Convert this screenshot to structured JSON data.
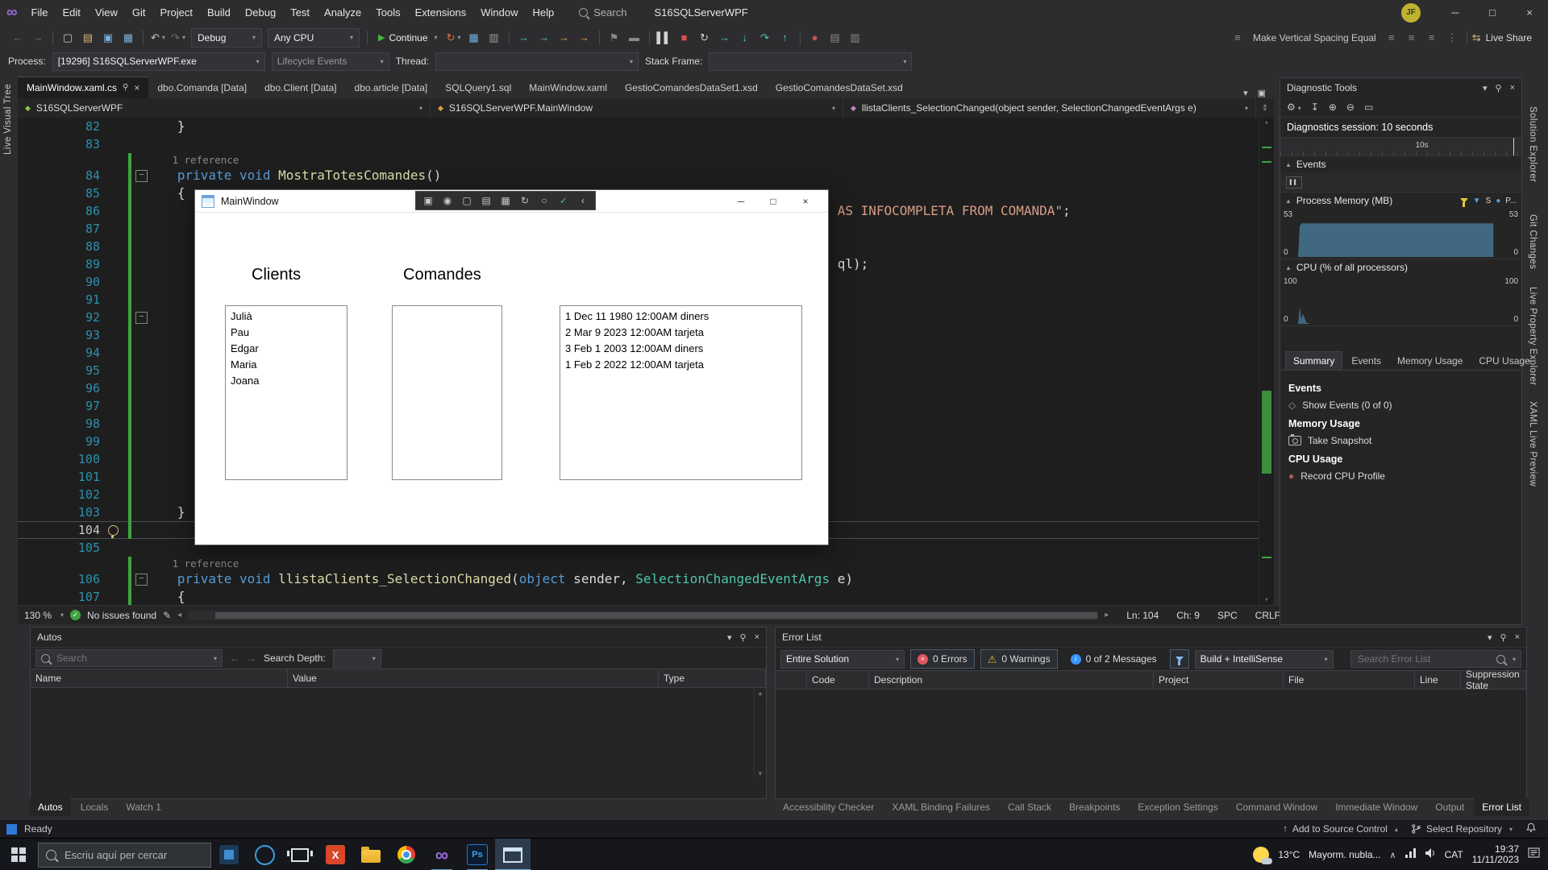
{
  "theme": {
    "accent": "#007acc",
    "editor_bg": "#1e1e1e",
    "shell_bg": "#2d2d30",
    "change_green": "#3fa33f",
    "stop_red": "#d85050"
  },
  "titlebar": {
    "menu": [
      "File",
      "Edit",
      "View",
      "Git",
      "Project",
      "Build",
      "Debug",
      "Test",
      "Analyze",
      "Tools",
      "Extensions",
      "Window",
      "Help"
    ],
    "search_label": "Search",
    "solution_title": "S16SQLServerWPF",
    "avatar_initials": "JF"
  },
  "toolbar": {
    "items": [
      {
        "k": "i",
        "n": "nav-back-icon",
        "g": "←",
        "c": "#6e6e6e"
      },
      {
        "k": "i",
        "n": "nav-forward-icon",
        "g": "→",
        "c": "#6e6e6e"
      },
      {
        "k": "s"
      },
      {
        "k": "i",
        "n": "new-file-icon",
        "g": "▢",
        "c": "#c8c8c8"
      },
      {
        "k": "i",
        "n": "open-file-icon",
        "g": "▤",
        "c": "#d8b26e"
      },
      {
        "k": "i",
        "n": "save-icon",
        "g": "▣",
        "c": "#7ab0dc"
      },
      {
        "k": "i",
        "n": "save-all-icon",
        "g": "▦",
        "c": "#7ab0dc"
      },
      {
        "k": "s"
      },
      {
        "k": "i",
        "n": "undo-icon",
        "g": "↶",
        "c": "#c8c8c8",
        "caret": 1
      },
      {
        "k": "i",
        "n": "redo-icon",
        "g": "↷",
        "c": "#6e6e6e",
        "caret": 1
      },
      {
        "k": "sel",
        "n": "debug-config-select",
        "label": "Debug",
        "w": 72
      },
      {
        "k": "sel",
        "n": "platform-select",
        "label": "Any CPU",
        "w": 98
      },
      {
        "k": "s"
      },
      {
        "k": "btn",
        "n": "continue-button",
        "label": "Continue"
      },
      {
        "k": "i",
        "n": "hot-reload-icon",
        "g": "↻",
        "c": "#e0703c",
        "caret": 1
      },
      {
        "k": "i",
        "n": "performance-profiler-icon",
        "g": "▦",
        "c": "#7ab0dc"
      },
      {
        "k": "i",
        "n": "diagnostics-icon",
        "g": "▥",
        "c": "#9a9a9a"
      },
      {
        "k": "s"
      },
      {
        "k": "i",
        "n": "navigate-backward-code-icon",
        "g": "→",
        "c": "#4ec9b0"
      },
      {
        "k": "i",
        "n": "navigate-forward-code-icon",
        "g": "→",
        "c": "#4ec9b0"
      },
      {
        "k": "i",
        "n": "goto-definition-icon",
        "g": "→",
        "c": "#e8a33a"
      },
      {
        "k": "i",
        "n": "goto-implementation-icon",
        "g": "→",
        "c": "#e8a33a"
      },
      {
        "k": "s"
      },
      {
        "k": "i",
        "n": "bookmark-icon",
        "g": "⚑",
        "c": "#8a8a8a"
      },
      {
        "k": "i",
        "n": "comment-icon",
        "g": "▬",
        "c": "#8a8a8a"
      },
      {
        "k": "s"
      },
      {
        "k": "i",
        "n": "pause-icon",
        "g": "▌▌",
        "c": "#d0d0d0"
      },
      {
        "k": "i",
        "n": "stop-icon",
        "g": "■",
        "c": "#d85050"
      },
      {
        "k": "i",
        "n": "restart-icon",
        "g": "↻",
        "c": "#d0d0d0"
      },
      {
        "k": "i",
        "n": "show-next-statement-icon",
        "g": "→",
        "c": "#4ec9b0"
      },
      {
        "k": "i",
        "n": "step-into-icon",
        "g": "↓",
        "c": "#4ec9b0"
      },
      {
        "k": "i",
        "n": "step-over-icon",
        "g": "↷",
        "c": "#4ec9b0"
      },
      {
        "k": "i",
        "n": "step-out-icon",
        "g": "↑",
        "c": "#4ec9b0"
      },
      {
        "k": "s"
      },
      {
        "k": "i",
        "n": "breakpoints-window-icon",
        "g": "●",
        "c": "#c75050"
      },
      {
        "k": "i",
        "n": "output-window-icon",
        "g": "▤",
        "c": "#8a8a8a"
      },
      {
        "k": "i",
        "n": "find-icon",
        "g": "▥",
        "c": "#8a8a8a"
      },
      {
        "k": "flex"
      },
      {
        "k": "i",
        "n": "align-tops-icon",
        "g": "≡",
        "c": "#8a8a8a"
      },
      {
        "k": "label",
        "n": "make-vertical-spacing-equal-label",
        "label": "Make Vertical Spacing Equal"
      },
      {
        "k": "i",
        "n": "align-lefts-icon",
        "g": "≡",
        "c": "#8a8a8a"
      },
      {
        "k": "i",
        "n": "align-centers-icon",
        "g": "≡",
        "c": "#8a8a8a"
      },
      {
        "k": "i",
        "n": "align-rights-icon",
        "g": "≡",
        "c": "#8a8a8a"
      },
      {
        "k": "i",
        "n": "make-horizontal-spacing-icon",
        "g": "⋮",
        "c": "#8a8a8a"
      },
      {
        "k": "s"
      },
      {
        "k": "live",
        "n": "live-share-button",
        "g": "⇆",
        "label": "Live Share"
      }
    ]
  },
  "process_bar": {
    "process_label": "Process:",
    "process_value": "[19296] S16SQLServerWPF.exe",
    "lifecycle_label": "Lifecycle Events",
    "thread_label": "Thread:",
    "stack_label": "Stack Frame:"
  },
  "doc_tabs": {
    "tabs": [
      {
        "label": "MainWindow.xaml.cs",
        "active": true
      },
      {
        "label": "dbo.Comanda [Data]"
      },
      {
        "label": "dbo.Client [Data]"
      },
      {
        "label": "dbo.article [Data]"
      },
      {
        "label": "SQLQuery1.sql"
      },
      {
        "label": "MainWindow.xaml"
      },
      {
        "label": "GestioComandesDataSet1.xsd"
      },
      {
        "label": "GestioComandesDataSet.xsd"
      }
    ]
  },
  "breadcrumb": {
    "items": [
      {
        "label": "S16SQLServerWPF"
      },
      {
        "label": "S16SQLServerWPF.MainWindow"
      },
      {
        "label": "llistaClients_SelectionChanged(object sender, SelectionChangedEventArgs e)"
      }
    ]
  },
  "editor": {
    "lines": [
      {
        "n": "82",
        "t": [
          [
            "p",
            "   }"
          ]
        ]
      },
      {
        "n": "83",
        "t": []
      },
      {
        "lens": "1 reference",
        "chg": true
      },
      {
        "n": "84",
        "chg": true,
        "fold": true,
        "t": [
          [
            "k",
            "   private void "
          ],
          [
            "m",
            "MostraTotesComandes"
          ],
          [
            "p",
            "()"
          ]
        ]
      },
      {
        "n": "85",
        "chg": true,
        "t": [
          [
            "p",
            "   {"
          ]
        ]
      },
      {
        "n": "86",
        "chg": true,
        "t": [
          [
            "s",
            "AS INFOCOMPLETA FROM COMANDA\"",
            88
          ],
          [
            "p",
            ";"
          ]
        ]
      },
      {
        "n": "87",
        "chg": true,
        "t": []
      },
      {
        "n": "88",
        "chg": true,
        "t": []
      },
      {
        "n": "89",
        "chg": true,
        "t": [
          [
            "p",
            "ql);",
            88
          ]
        ]
      },
      {
        "n": "90",
        "chg": true,
        "t": []
      },
      {
        "n": "91",
        "chg": true,
        "t": []
      },
      {
        "n": "92",
        "chg": true,
        "fold": true,
        "t": []
      },
      {
        "n": "93",
        "chg": true,
        "t": []
      },
      {
        "n": "94",
        "chg": true,
        "t": []
      },
      {
        "n": "95",
        "chg": true,
        "t": []
      },
      {
        "n": "96",
        "chg": true,
        "t": []
      },
      {
        "n": "97",
        "chg": true,
        "t": []
      },
      {
        "n": "98",
        "chg": true,
        "t": []
      },
      {
        "n": "99",
        "chg": true,
        "t": []
      },
      {
        "n": "100",
        "chg": true,
        "t": []
      },
      {
        "n": "101",
        "chg": true,
        "t": []
      },
      {
        "n": "102",
        "chg": true,
        "t": []
      },
      {
        "n": "103",
        "chg": true,
        "t": [
          [
            "p",
            "   }"
          ]
        ]
      },
      {
        "n": "104",
        "chg": true,
        "cur": true,
        "t": []
      },
      {
        "n": "105",
        "t": []
      },
      {
        "lens": "1 reference",
        "chg": true
      },
      {
        "n": "106",
        "chg": true,
        "fold": true,
        "t": [
          [
            "k",
            "   private void "
          ],
          [
            "m",
            "llistaClients_SelectionChanged"
          ],
          [
            "p",
            "("
          ],
          [
            "k",
            "object"
          ],
          [
            "p",
            " sender, "
          ],
          [
            "y",
            "SelectionChangedEventArgs"
          ],
          [
            "p",
            " e)"
          ]
        ]
      },
      {
        "n": "107",
        "chg": true,
        "t": [
          [
            "p",
            "   {"
          ]
        ]
      }
    ],
    "status": {
      "zoom": "130 %",
      "health": "No issues found",
      "ln": "Ln: 104",
      "ch": "Ch: 9",
      "spc": "SPC",
      "eol": "CRLF"
    }
  },
  "wpf_window": {
    "title": "MainWindow",
    "clients_heading": "Clients",
    "comandes_heading": "Comandes",
    "clients": [
      "Julià",
      "Pau",
      "Edgar",
      "Maria",
      "Joana"
    ],
    "comandes": [
      "1 Dec 11 1980 12:00AM diners",
      "2 Mar 9 2023 12:00AM tarjeta",
      "3 Feb 1 2003 12:00AM diners",
      "1 Feb 2 2022 12:00AM tarjeta"
    ],
    "overlay_icons": [
      {
        "n": "select-element-icon",
        "g": "▣"
      },
      {
        "n": "screenshot-icon",
        "g": "◉"
      },
      {
        "n": "inspect-element-icon",
        "g": "▢"
      },
      {
        "n": "show-adorners-icon",
        "g": "▤"
      },
      {
        "n": "show-layout-grid-icon",
        "g": "▦"
      },
      {
        "n": "hot-reload-icon",
        "g": "↻"
      },
      {
        "n": "accessibility-checker-icon",
        "g": "○"
      },
      {
        "n": "xaml-hot-reload-ok-icon",
        "g": "✓",
        "c": "#5bb85b"
      },
      {
        "n": "collapse-overlay-icon",
        "g": "‹"
      }
    ]
  },
  "diagnostics": {
    "title": "Diagnostic Tools",
    "session_label": "Diagnostics session: 10 seconds",
    "time_tick": "10s",
    "events_label": "Events",
    "memory_label": "Process Memory (MB)",
    "memory_max": "53",
    "memory_min": "0",
    "cpu_label": "CPU (% of all processors)",
    "cpu_max": "100",
    "cpu_min": "0",
    "legend_s": "S",
    "legend_p": "P...",
    "tabs": [
      {
        "label": "Summary",
        "active": true
      },
      {
        "label": "Events"
      },
      {
        "label": "Memory Usage"
      },
      {
        "label": "CPU Usage"
      }
    ],
    "summary_events_header": "Events",
    "show_events": "Show Events (0 of 0)",
    "summary_memory_header": "Memory Usage",
    "take_snapshot": "Take Snapshot",
    "summary_cpu_header": "CPU Usage",
    "record_cpu": "Record CPU Profile",
    "memory_points": [
      [
        0,
        100
      ],
      [
        0.8,
        34
      ],
      [
        1.6,
        28
      ],
      [
        95,
        28
      ],
      [
        95,
        100
      ]
    ],
    "cpu_points": [
      [
        0,
        100
      ],
      [
        0.8,
        64
      ],
      [
        1.6,
        90
      ],
      [
        2.4,
        78
      ],
      [
        4,
        97
      ],
      [
        6,
        100
      ],
      [
        95,
        100
      ]
    ]
  },
  "left_strip": {
    "tabs": [
      "Live Visual Tree"
    ]
  },
  "right_strip": {
    "tabs": [
      "Solution Explorer",
      "Git Changes",
      "Live Property Explorer",
      "XAML Live Preview"
    ]
  },
  "autos": {
    "title": "Autos",
    "search_placeholder": "Search",
    "depth_label": "Search Depth:",
    "columns": [
      "Name",
      "Value",
      "Type"
    ],
    "tabs": [
      {
        "label": "Autos",
        "active": true
      },
      {
        "label": "Locals"
      },
      {
        "label": "Watch 1"
      }
    ]
  },
  "error_list": {
    "title": "Error List",
    "scope": "Entire Solution",
    "errors": "0 Errors",
    "warnings": "0 Warnings",
    "messages": "0 of 2 Messages",
    "build_filter": "Build + IntelliSense",
    "search_placeholder": "Search Error List",
    "columns": [
      "Code",
      "Description",
      "Project",
      "File",
      "Line",
      "Suppression State"
    ],
    "tabs": [
      {
        "label": "Accessibility Checker"
      },
      {
        "label": "XAML Binding Failures"
      },
      {
        "label": "Call Stack"
      },
      {
        "label": "Breakpoints"
      },
      {
        "label": "Exception Settings"
      },
      {
        "label": "Command Window"
      },
      {
        "label": "Immediate Window"
      },
      {
        "label": "Output"
      },
      {
        "label": "Error List",
        "active": true
      }
    ]
  },
  "status_bar": {
    "ready": "Ready",
    "add_source": "Add to Source Control",
    "select_repo": "Select Repository"
  },
  "taskbar": {
    "search_placeholder": "Escriu aquí per cercar",
    "apps": [
      {
        "name": "taskbar-app-blue-square",
        "style": "bluesq"
      },
      {
        "name": "taskbar-app-blue-circle",
        "style": "bluecirc"
      },
      {
        "name": "taskbar-task-view-button",
        "style": "taskview"
      },
      {
        "name": "taskbar-app-orange-x",
        "style": "xapp",
        "g": "X"
      },
      {
        "name": "taskbar-app-file-explorer",
        "style": "folder"
      },
      {
        "name": "taskbar-app-chrome",
        "style": "chrome"
      },
      {
        "name": "taskbar-app-visual-studio",
        "style": "vs",
        "g": "∞",
        "running": true
      },
      {
        "name": "taskbar-app-photoshop",
        "style": "ps",
        "g": "Ps",
        "running": true
      },
      {
        "name": "taskbar-app-mainwindow",
        "style": "wpf",
        "active": true
      }
    ],
    "weather_temp": "13°C",
    "weather_desc": "Mayorm. nubla...",
    "lang": "CAT",
    "time": "19:37",
    "date": "11/11/2023"
  }
}
